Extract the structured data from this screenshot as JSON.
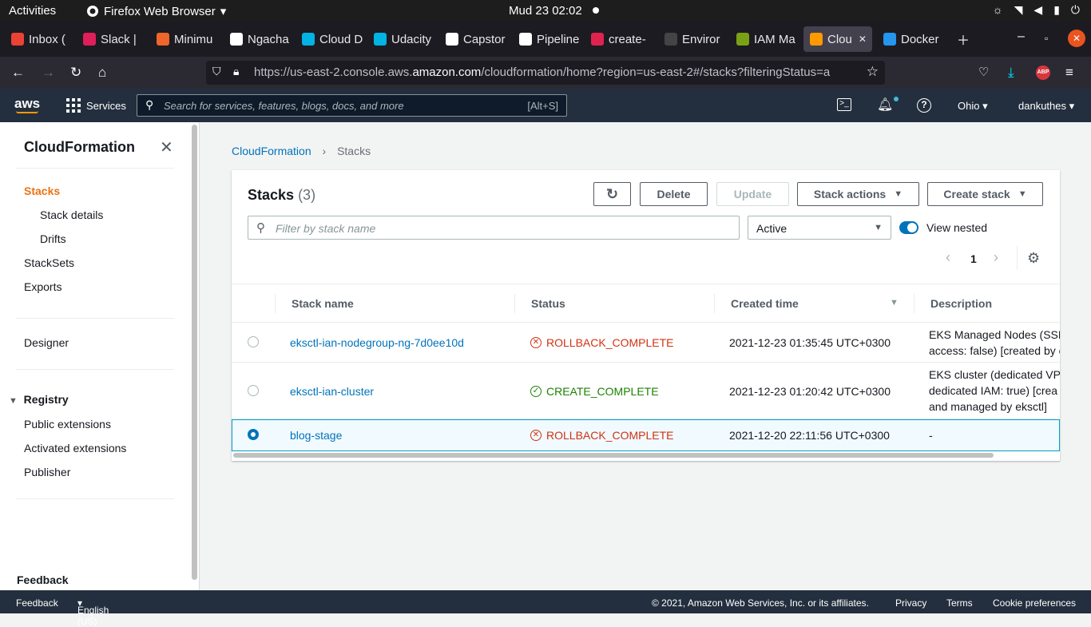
{
  "os_bar": {
    "activities": "Activities",
    "app_name": "Firefox Web Browser",
    "clock": "Mud 23  02:02"
  },
  "browser": {
    "tabs": [
      {
        "label": "Inbox (",
        "color": "#ea4335"
      },
      {
        "label": "Slack | ",
        "color": "#e01e5a"
      },
      {
        "label": "Minimu",
        "color": "#f06529"
      },
      {
        "label": "Ngacha",
        "color": "#ffffff"
      },
      {
        "label": "Cloud D",
        "color": "#02b3e4"
      },
      {
        "label": "Udacity",
        "color": "#02b3e4"
      },
      {
        "label": "Capstor",
        "color": "#ffffff"
      },
      {
        "label": "Pipeline",
        "color": "#ffffff"
      },
      {
        "label": "create-",
        "color": "#e0234e"
      },
      {
        "label": "Enviror",
        "color": "#444444"
      },
      {
        "label": "IAM Ma",
        "color": "#7aa116"
      },
      {
        "label": "Clou",
        "color": "#ff9900"
      },
      {
        "label": "Docker",
        "color": "#2496ed"
      }
    ],
    "url_prefix": "https://us-east-2.console.aws.",
    "url_domain": "amazon.com",
    "url_suffix": "/cloudformation/home?region=us-east-2#/stacks?filteringStatus=a",
    "abp": "ABP"
  },
  "aws_nav": {
    "logo": "aws",
    "services": "Services",
    "search_placeholder": "Search for services, features, blogs, docs, and more",
    "shortcut": "[Alt+S]",
    "region": "Ohio",
    "account": "dankuthes"
  },
  "sidebar": {
    "title": "CloudFormation",
    "items": [
      "Stacks",
      "Stack details",
      "Drifts",
      "StackSets",
      "Exports"
    ],
    "designer": "Designer",
    "registry": "Registry",
    "registry_items": [
      "Public extensions",
      "Activated extensions",
      "Publisher"
    ],
    "feedback": "Feedback"
  },
  "breadcrumb": {
    "root": "CloudFormation",
    "current": "Stacks"
  },
  "panel": {
    "title": "Stacks",
    "count": "(3)",
    "delete": "Delete",
    "update": "Update",
    "stack_actions": "Stack actions",
    "create_stack": "Create stack",
    "filter_placeholder": "Filter by stack name",
    "status_filter": "Active",
    "view_nested": "View nested",
    "page": "1"
  },
  "table": {
    "headers": [
      "Stack name",
      "Status",
      "Created time",
      "Description"
    ],
    "rows": [
      {
        "name": "eksctl-ian-nodegroup-ng-7d0ee10d",
        "status": "ROLLBACK_COMPLETE",
        "created": "2021-12-23 01:35:45 UTC+0300",
        "desc1": "EKS Managed Nodes (SSH",
        "desc2": "access: false) [created by e",
        "desc3": ""
      },
      {
        "name": "eksctl-ian-cluster",
        "status": "CREATE_COMPLETE",
        "created": "2021-12-23 01:20:42 UTC+0300",
        "desc1": "EKS cluster (dedicated VP",
        "desc2": "dedicated IAM: true) [crea",
        "desc3": "and managed by eksctl]"
      },
      {
        "name": "blog-stage",
        "status": "ROLLBACK_COMPLETE",
        "created": "2021-12-20 22:11:56 UTC+0300",
        "desc1": "-",
        "desc2": "",
        "desc3": ""
      }
    ]
  },
  "footer": {
    "feedback": "Feedback",
    "language": "English (US)",
    "copyright": "© 2021, Amazon Web Services, Inc. or its affiliates.",
    "privacy": "Privacy",
    "terms": "Terms",
    "cookies": "Cookie preferences"
  }
}
